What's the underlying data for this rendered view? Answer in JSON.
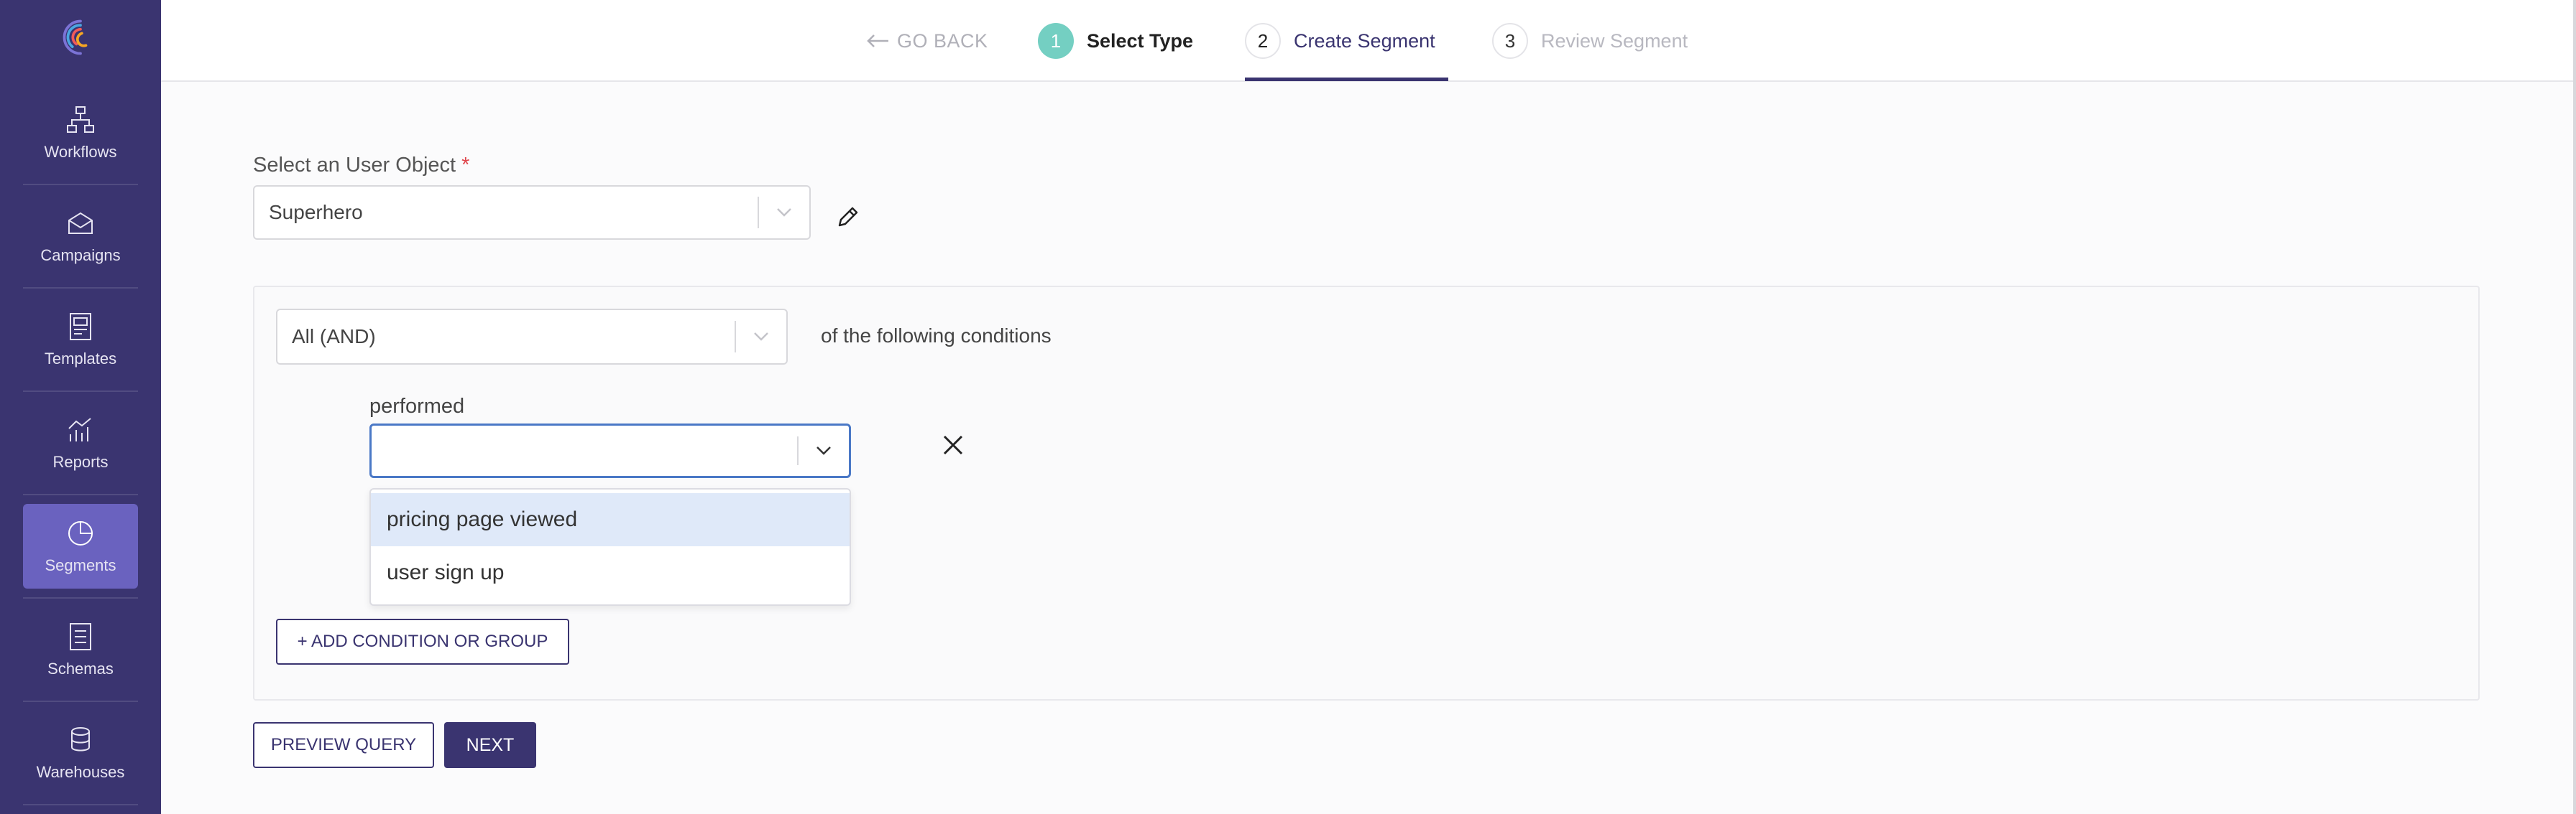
{
  "sidebar": {
    "items": [
      {
        "label": "Workflows",
        "icon": "workflow-icon"
      },
      {
        "label": "Campaigns",
        "icon": "campaign-icon"
      },
      {
        "label": "Templates",
        "icon": "template-icon"
      },
      {
        "label": "Reports",
        "icon": "report-icon"
      },
      {
        "label": "Segments",
        "icon": "segment-icon",
        "active": true
      },
      {
        "label": "Schemas",
        "icon": "schema-icon"
      },
      {
        "label": "Warehouses",
        "icon": "warehouse-icon"
      }
    ]
  },
  "stepper": {
    "go_back": "GO BACK",
    "steps": [
      {
        "num": "1",
        "label": "Select Type",
        "state": "completed"
      },
      {
        "num": "2",
        "label": "Create Segment",
        "state": "active"
      },
      {
        "num": "3",
        "label": "Review Segment",
        "state": "pending"
      }
    ]
  },
  "form": {
    "user_object_label": "Select an User Object",
    "required_mark": "*",
    "user_object_value": "Superhero",
    "logic_value": "All (AND)",
    "conditions_text": "of the following conditions",
    "performed_label": "performed",
    "performed_value": "",
    "dropdown_options": [
      "pricing page viewed",
      "user sign up"
    ],
    "add_condition_label": "+ ADD CONDITION OR GROUP",
    "preview_label": "PREVIEW QUERY",
    "next_label": "NEXT"
  },
  "colors": {
    "sidebar": "#3a3470",
    "sidebar_active": "#6a62bf",
    "accent": "#3a3470",
    "step_done": "#74cfc2",
    "focus": "#4a78c6",
    "option_highlight": "#dfe9f9"
  }
}
